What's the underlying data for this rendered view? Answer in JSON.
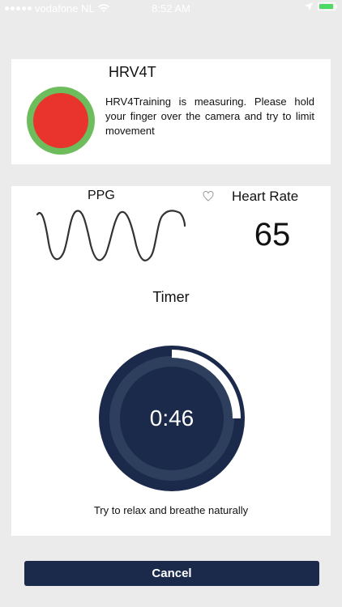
{
  "status_bar": {
    "carrier": "vodafone NL",
    "time": "8:52 AM",
    "battery_level": 0.95,
    "wifi_icon": "wifi-icon",
    "location_icon": "location-arrow-icon"
  },
  "header": {
    "title": "HRV4T"
  },
  "measurement": {
    "message": "HRV4Training is measuring. Please hold your finger over the camera and try to limit movement",
    "indicator_icon": "recording-dot-icon",
    "indicator_color": "#e8342c",
    "indicator_ring_color": "#6ebd5c"
  },
  "ppg": {
    "label": "PPG"
  },
  "heart_rate": {
    "label": "Heart Rate",
    "value": "65",
    "icon": "heart-outline-icon"
  },
  "timer": {
    "label": "Timer",
    "value": "0:46",
    "progress": 0.25,
    "ring_color": "#1b2a4a",
    "progress_color": "#ffffff"
  },
  "instruction": "Try to relax and breathe naturally",
  "actions": {
    "cancel_label": "Cancel"
  }
}
